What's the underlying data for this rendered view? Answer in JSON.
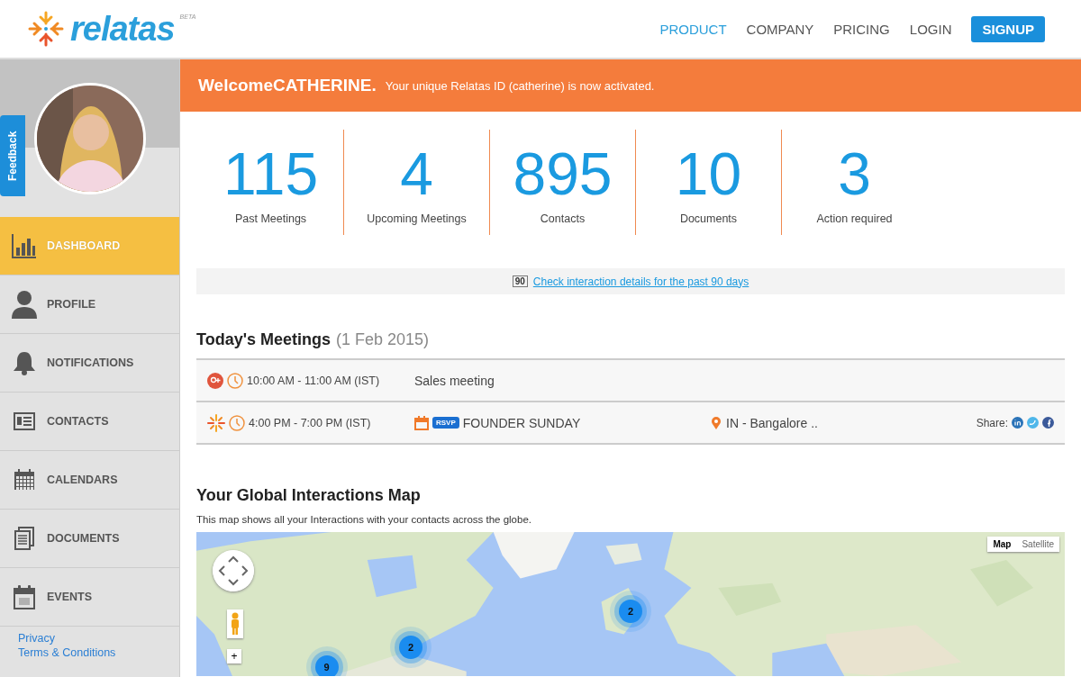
{
  "header": {
    "logo": "relatas",
    "logo_badge": "BETA",
    "nav": [
      {
        "label": "PRODUCT",
        "selected": true
      },
      {
        "label": "COMPANY",
        "selected": false
      },
      {
        "label": "PRICING",
        "selected": false
      },
      {
        "label": "LOGIN",
        "selected": false
      }
    ],
    "signup": "SIGNUP"
  },
  "feedback_tab": "Feedback",
  "sidebar": {
    "items": [
      {
        "label": "DASHBOARD",
        "selected": true
      },
      {
        "label": "PROFILE",
        "selected": false
      },
      {
        "label": "NOTIFICATIONS",
        "selected": false
      },
      {
        "label": "CONTACTS",
        "selected": false
      },
      {
        "label": "CALENDARS",
        "selected": false
      },
      {
        "label": "DOCUMENTS",
        "selected": false
      },
      {
        "label": "EVENTS",
        "selected": false
      }
    ],
    "links": [
      "Privacy",
      "Terms & Conditions"
    ]
  },
  "banner": {
    "greeting": "Welcome",
    "name": "CATHERINE.",
    "message": "Your unique Relatas ID (catherine) is now activated."
  },
  "stats": [
    {
      "value": "115",
      "label": "Past Meetings"
    },
    {
      "value": "4",
      "label": "Upcoming Meetings"
    },
    {
      "value": "895",
      "label": "Contacts"
    },
    {
      "value": "10",
      "label": "Documents"
    },
    {
      "value": "3",
      "label": "Action required"
    }
  ],
  "interaction_link": {
    "badge": "90",
    "text": "Check interaction details for the past 90 days"
  },
  "meetings": {
    "title": "Today's Meetings",
    "date": "(1 Feb 2015)",
    "rows": [
      {
        "kind": "google",
        "time": "10:00 AM - 11:00 AM (IST)",
        "title": "Sales meeting"
      },
      {
        "kind": "event",
        "time": "4:00 PM - 7:00 PM (IST)",
        "rsvp": "RSVP",
        "title": "FOUNDER SUNDAY",
        "location": "IN - Bangalore ..",
        "share_label": "Share:"
      }
    ]
  },
  "map_section": {
    "title": "Your Global Interactions Map",
    "description": "This map shows all your Interactions with your contacts across the globe.",
    "map": {
      "map_types": [
        {
          "label": "Map",
          "selected": true
        },
        {
          "label": "Satellite",
          "selected": false
        }
      ],
      "clusters": [
        "9",
        "2",
        "2"
      ],
      "zoom_in": "+"
    }
  }
}
